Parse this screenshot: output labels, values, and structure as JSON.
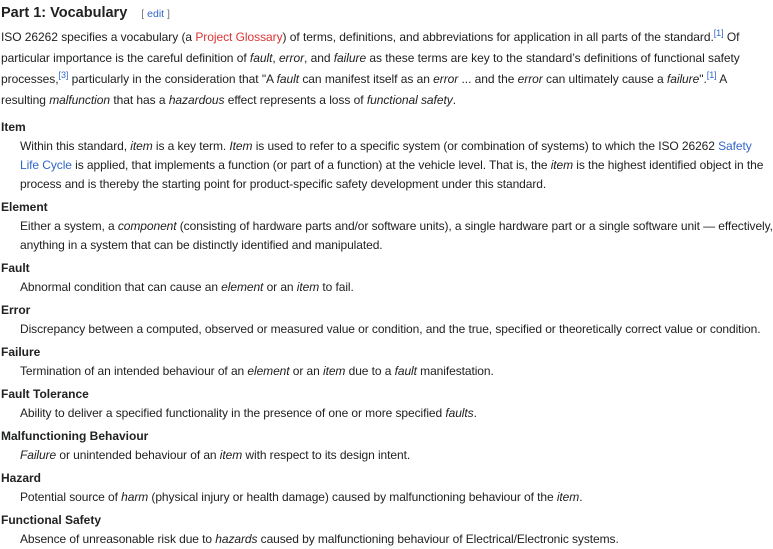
{
  "section": {
    "title": "Part 1: Vocabulary",
    "edit_open": "[ ",
    "edit_label": "edit",
    "edit_close": " ]"
  },
  "intro": [
    {
      "t": "ISO 26262 specifies a vocabulary (a "
    },
    {
      "t": "Project Glossary",
      "s": "red"
    },
    {
      "t": ") of terms, definitions, and abbreviations for application in all parts of the standard."
    },
    {
      "t": "[1]",
      "s": "sup"
    },
    {
      "t": " Of particular importance is the careful definition of "
    },
    {
      "t": "fault",
      "s": "i"
    },
    {
      "t": ", "
    },
    {
      "t": "error",
      "s": "i"
    },
    {
      "t": ", and "
    },
    {
      "t": "failure",
      "s": "i"
    },
    {
      "t": " as these terms are key to the standard’s definitions of functional safety processes,"
    },
    {
      "t": "[3]",
      "s": "sup"
    },
    {
      "t": " particularly in the consideration that \"A "
    },
    {
      "t": "fault",
      "s": "i"
    },
    {
      "t": " can manifest itself as an "
    },
    {
      "t": "error",
      "s": "i"
    },
    {
      "t": " ... and the "
    },
    {
      "t": "error",
      "s": "i"
    },
    {
      "t": " can ultimately cause a "
    },
    {
      "t": "failure",
      "s": "i"
    },
    {
      "t": "\"."
    },
    {
      "t": "[1]",
      "s": "sup"
    },
    {
      "t": " A resulting "
    },
    {
      "t": "malfunction",
      "s": "i"
    },
    {
      "t": " that has a "
    },
    {
      "t": "hazardous",
      "s": "i"
    },
    {
      "t": " effect represents a loss of "
    },
    {
      "t": "functional safety",
      "s": "i"
    },
    {
      "t": "."
    }
  ],
  "terms": [
    {
      "term": "Item",
      "def": [
        {
          "t": "Within this standard, "
        },
        {
          "t": "item",
          "s": "i"
        },
        {
          "t": " is a key term. "
        },
        {
          "t": "Item",
          "s": "i"
        },
        {
          "t": " is used to refer to a specific system (or combination of systems) to which the ISO 26262 "
        },
        {
          "t": "Safety Life Cycle",
          "s": "link"
        },
        {
          "t": " is applied, that implements a function (or part of a function) at the vehicle level. That is, the "
        },
        {
          "t": "item",
          "s": "i"
        },
        {
          "t": " is the highest identified object in the process and is thereby the starting point for product-specific safety development under this standard."
        }
      ]
    },
    {
      "term": "Element",
      "def": [
        {
          "t": "Either a system, a "
        },
        {
          "t": "component",
          "s": "i"
        },
        {
          "t": " (consisting of hardware parts and/or software units), a single hardware part or a single software unit — effectively, anything in a system that can be distinctly identified and manipulated."
        }
      ]
    },
    {
      "term": "Fault",
      "def": [
        {
          "t": "Abnormal condition that can cause an "
        },
        {
          "t": "element",
          "s": "i"
        },
        {
          "t": " or an "
        },
        {
          "t": "item",
          "s": "i"
        },
        {
          "t": " to fail."
        }
      ]
    },
    {
      "term": "Error",
      "def": [
        {
          "t": "Discrepancy between a computed, observed or measured value or condition, and the true, specified or theoretically correct value or condition."
        }
      ]
    },
    {
      "term": "Failure",
      "def": [
        {
          "t": "Termination of an intended behaviour of an "
        },
        {
          "t": "element",
          "s": "i"
        },
        {
          "t": " or an "
        },
        {
          "t": "item",
          "s": "i"
        },
        {
          "t": " due to a "
        },
        {
          "t": "fault",
          "s": "i"
        },
        {
          "t": " manifestation."
        }
      ]
    },
    {
      "term": "Fault Tolerance",
      "def": [
        {
          "t": "Ability to deliver a specified functionality in the presence of one or more specified "
        },
        {
          "t": "faults",
          "s": "i"
        },
        {
          "t": "."
        }
      ]
    },
    {
      "term": "Malfunctioning Behaviour",
      "def": [
        {
          "t": "Failure",
          "s": "i"
        },
        {
          "t": " or unintended behaviour of an "
        },
        {
          "t": "item",
          "s": "i"
        },
        {
          "t": " with respect to its design intent."
        }
      ]
    },
    {
      "term": "Hazard",
      "def": [
        {
          "t": "Potential source of "
        },
        {
          "t": "harm",
          "s": "i"
        },
        {
          "t": " (physical injury or health damage) caused by malfunctioning behaviour of the "
        },
        {
          "t": "item",
          "s": "i"
        },
        {
          "t": "."
        }
      ]
    },
    {
      "term": "Functional Safety",
      "def": [
        {
          "t": "Absence of unreasonable risk due to "
        },
        {
          "t": "hazards",
          "s": "i"
        },
        {
          "t": " caused by malfunctioning behaviour of Electrical/Electronic systems."
        }
      ]
    }
  ]
}
